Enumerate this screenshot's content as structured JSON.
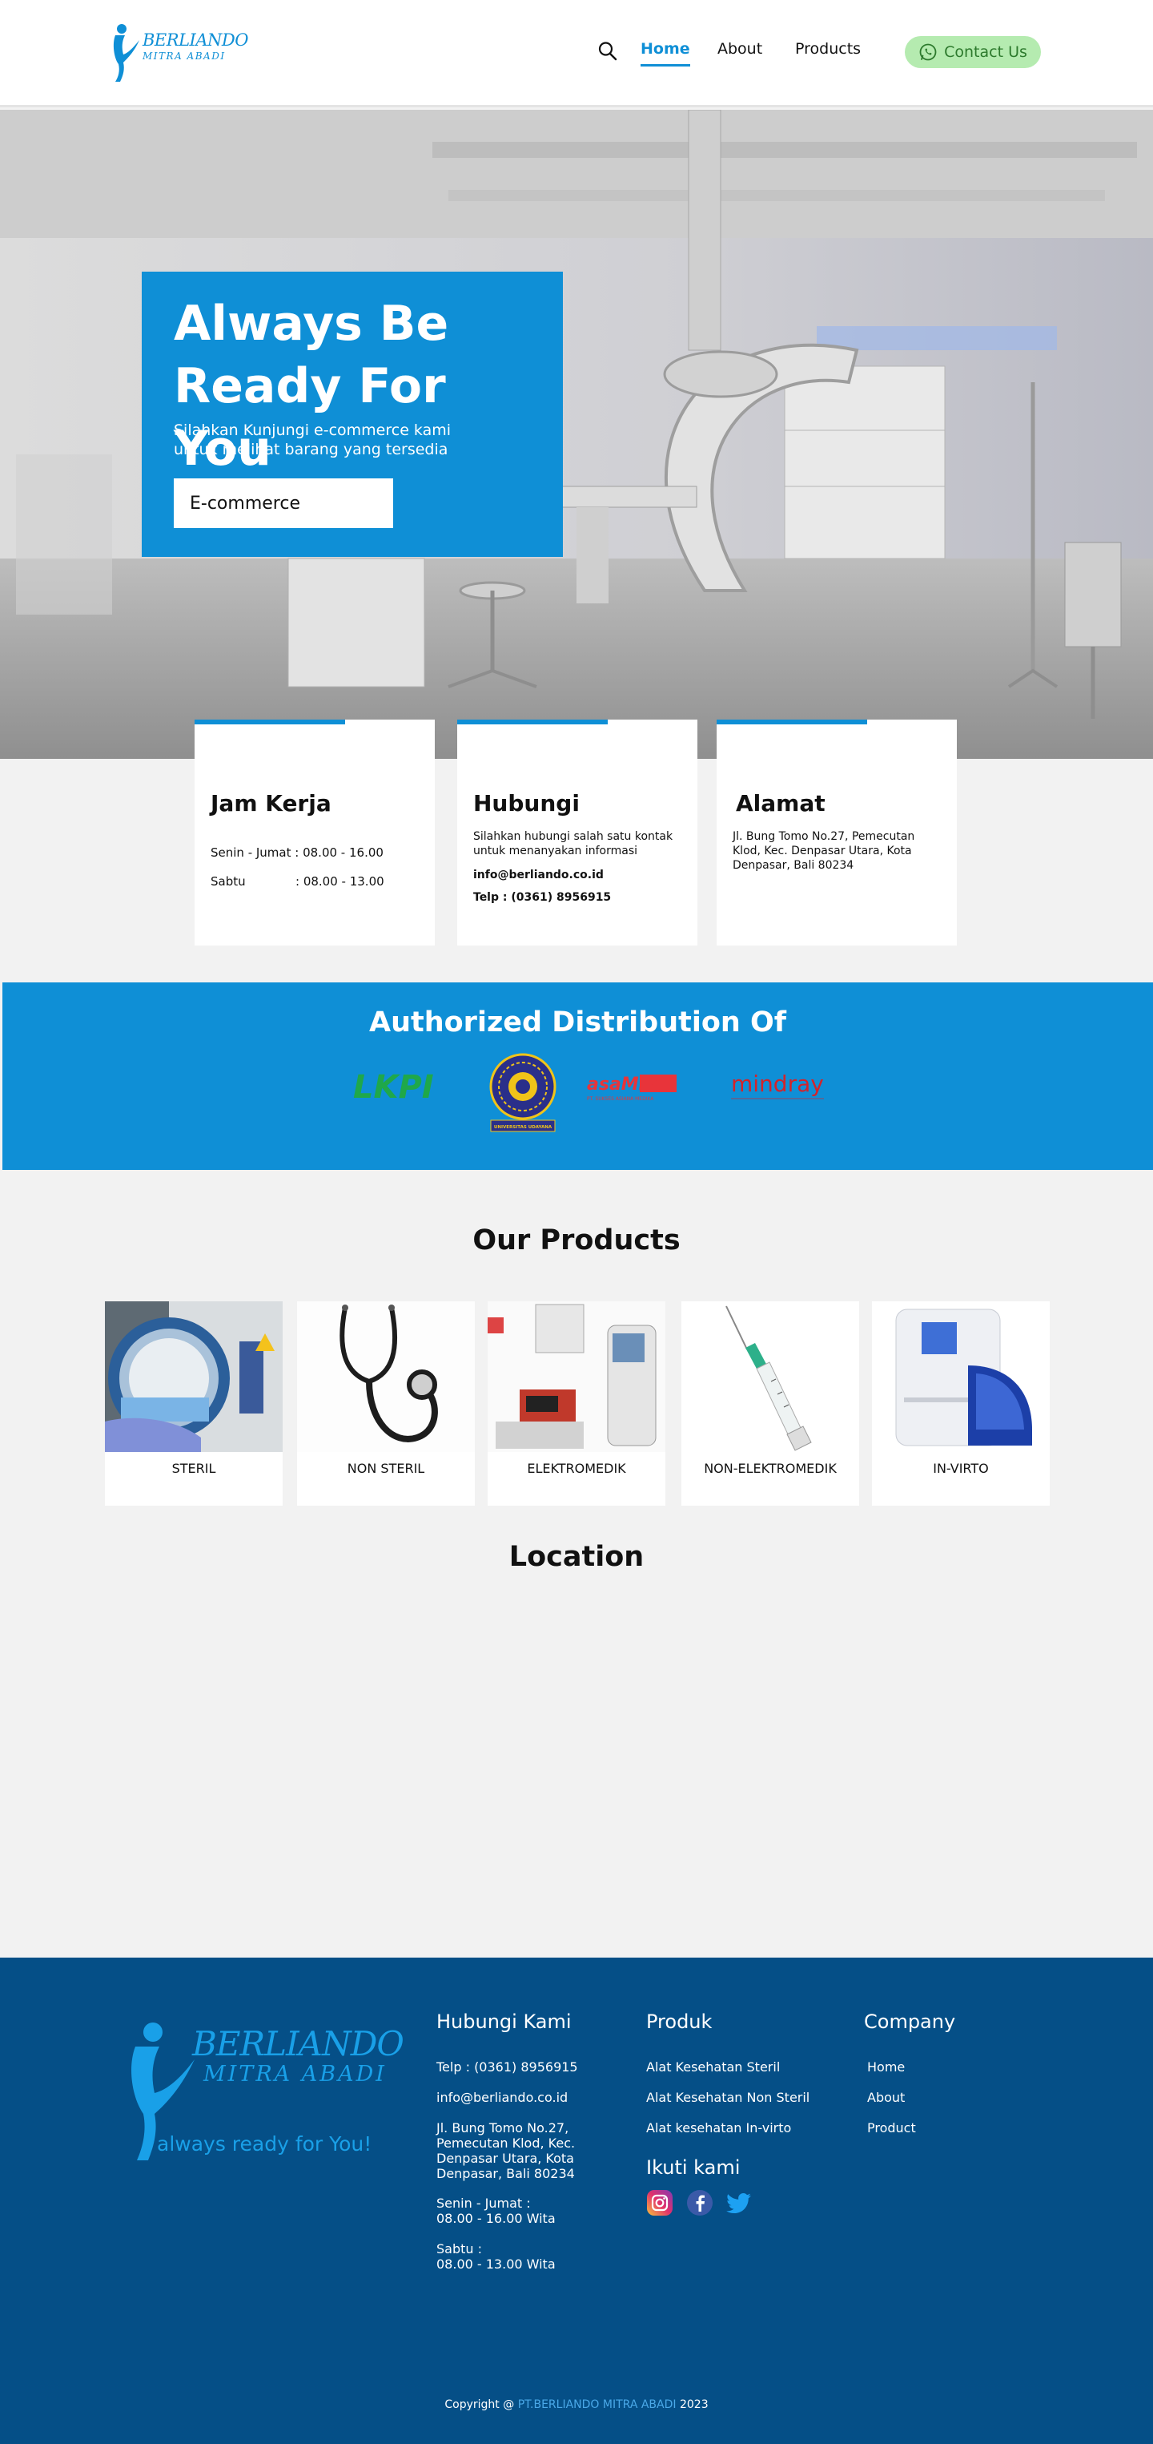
{
  "header": {
    "logo_line1": "BERLIANDO",
    "logo_line2": "MITRA ABADI",
    "nav": {
      "home": "Home",
      "about": "About",
      "products": "Products"
    },
    "contact_label": "Contact Us"
  },
  "hero": {
    "title": "Always Be Ready For You",
    "subtitle": "Silahkan Kunjungi e-commerce kami untuk melihat barang yang tersedia",
    "button_label": "E-commerce"
  },
  "info": {
    "jam_kerja": {
      "title": "Jam Kerja",
      "row1_label": "Senin - Jumat : 08.00 - 16.00",
      "row2_label": "Sabtu",
      "row2_time": ": 08.00 - 13.00"
    },
    "hubungi": {
      "title": "Hubungi",
      "text": "Silahkan hubungi salah satu kontak untuk menanyakan informasi",
      "email": "info@berliando.co.id",
      "phone": "Telp : (0361) 8956915"
    },
    "alamat": {
      "title": "Alamat",
      "text": "Jl. Bung Tomo No.27, Pemecutan Klod, Kec. Denpasar Utara, Kota Denpasar, Bali 80234"
    }
  },
  "authorized": {
    "title": "Authorized Distribution Of",
    "logos": {
      "lkpi": "LKPI",
      "univ": "UNIVERSITAS UDAYANA",
      "asamed": "asaMED",
      "asamed_sub": "PT. SUKSES ASIANA MEDIKA",
      "mindray": "mindray"
    }
  },
  "products": {
    "title": "Our Products",
    "items": [
      "STERIL",
      "NON STERIL",
      "ELEKTROMEDIK",
      "NON-ELEKTROMEDIK",
      "IN-VIRTO"
    ]
  },
  "location": {
    "title": "Location"
  },
  "footer": {
    "logo_line1": "BERLIANDO",
    "logo_line2": "MITRA ABADI",
    "tagline": "always ready for You!",
    "hubungi": {
      "title": "Hubungi Kami",
      "phone": "Telp : (0361) 8956915",
      "email": "info@berliando.co.id",
      "address": "Jl. Bung Tomo No.27, Pemecutan Klod, Kec. Denpasar Utara, Kota Denpasar, Bali 80234",
      "weekday_label": "Senin - Jumat :",
      "weekday_time": "08.00 - 16.00 Wita",
      "saturday_label": "Sabtu :",
      "saturday_time": "08.00 - 13.00 Wita"
    },
    "produk": {
      "title": "Produk",
      "items": [
        "Alat Kesehatan Steril",
        "Alat Kesehatan Non Steril",
        "Alat kesehatan In-virto"
      ]
    },
    "ikuti": {
      "title": "Ikuti kami"
    },
    "company": {
      "title": "Company",
      "items": [
        "Home",
        "About",
        "Product"
      ]
    },
    "copyright_prefix": "Copyright @",
    "copyright_brand": "PT.BERLIANDO MITRA ABADI",
    "copyright_year": "2023"
  },
  "colors": {
    "primary": "#0f8fd6",
    "footer_bg": "#054f87",
    "contact_bg": "#b5ebb0",
    "page_bg": "#f2f2f2"
  },
  "icons": [
    "search-icon",
    "whatsapp-icon",
    "instagram-icon",
    "facebook-icon",
    "twitter-icon"
  ]
}
